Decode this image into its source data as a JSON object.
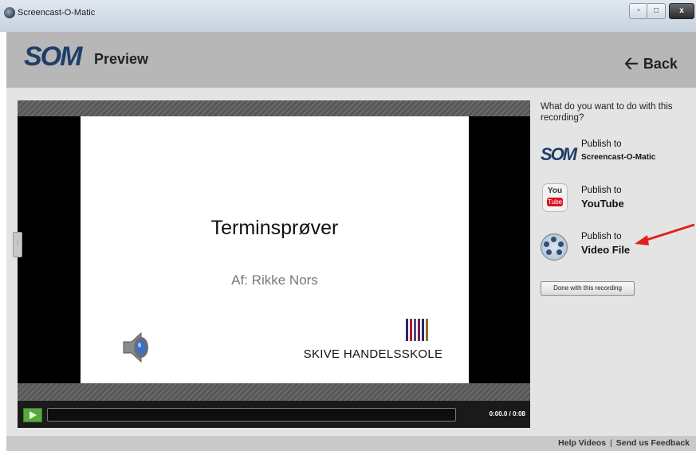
{
  "window": {
    "title": "Screencast-O-Matic",
    "close_label": "x"
  },
  "header": {
    "logo": "SOM",
    "title": "Preview",
    "back_label": "Back"
  },
  "player": {
    "slide_title": "Terminsprøver",
    "slide_subtitle": "Af: Rikke Nors",
    "school_name": "SKIVE HANDELSSKOLE",
    "timecode": "0:00.0 / 0:08",
    "progress": 0
  },
  "panel": {
    "question": "What do you want to do with this recording?",
    "options": [
      {
        "icon": "som-logo-icon",
        "icon_text": "SOM",
        "line1": "Publish to",
        "line2": "Screencast-O-Matic"
      },
      {
        "icon": "youtube-icon",
        "icon_text_top": "You",
        "icon_text_bottom": "Tube",
        "line1": "Publish to",
        "line2": "YouTube"
      },
      {
        "icon": "film-reel-icon",
        "line1": "Publish to",
        "line2": "Video File"
      }
    ],
    "done_label": "Done with this recording"
  },
  "footer": {
    "help_label": "Help Videos",
    "separator": "|",
    "feedback_label": "Send us Feedback"
  },
  "colors": {
    "header_bg": "#b7b7b7",
    "main_bg": "#e4e4e4",
    "accent_red": "#e0201b",
    "play_green": "#58a83f",
    "logo_blue": "#1f3e6a"
  }
}
